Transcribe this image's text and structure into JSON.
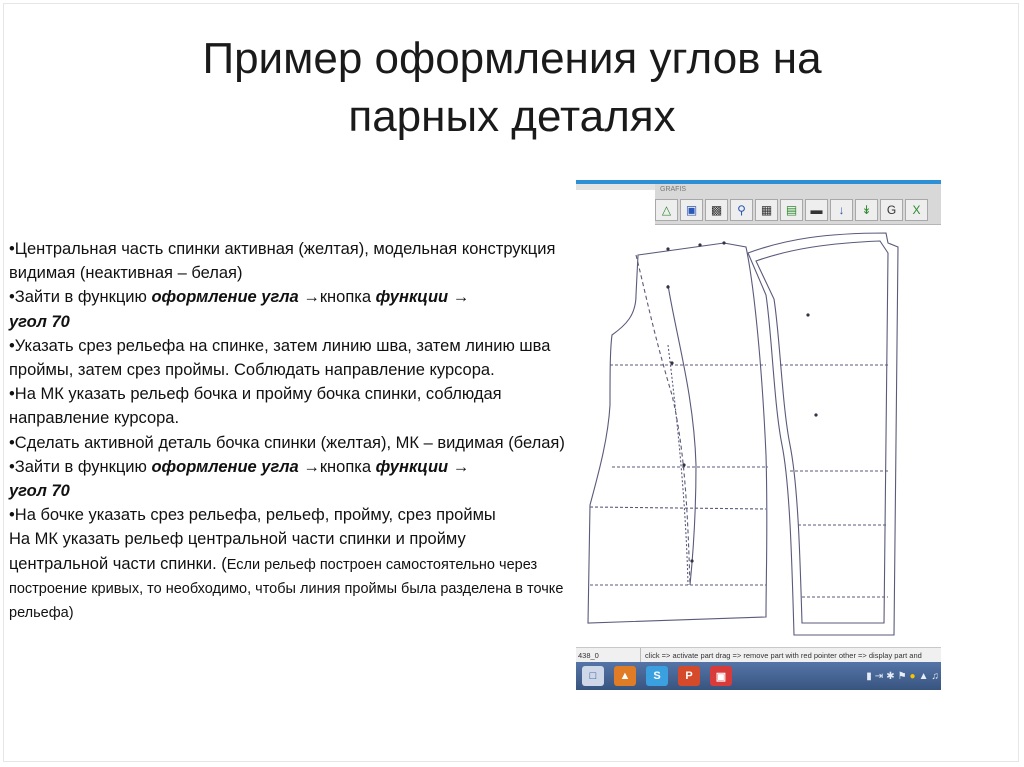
{
  "title": {
    "line1": "Пример оформления углов на",
    "line2": "парных деталях"
  },
  "instructions": {
    "p1": "•Центральная часть спинки активная (желтая), модельная конструкция видимая (неактивная – белая)",
    "p2": {
      "pre": "•Зайти в функцию ",
      "func": "оформление угла",
      "mid": " →кнопка ",
      "btn": "функции",
      "arrow": " →",
      "angle": "угол 70"
    },
    "p3": "•Указать срез рельефа на спинке, затем линию шва, затем линию шва проймы, затем срез проймы. Соблюдать направление курсора.",
    "p4": "•На МК указать рельеф бочка и пройму бочка спинки, соблюдая направление курсора.",
    "p5": "•Сделать активной деталь бочка спинки (желтая), МК – видимая (белая)",
    "p6": {
      "pre": "•Зайти в функцию ",
      "func": "оформление угла",
      "mid": " →кнопка ",
      "btn": "функции",
      "arrow": " →",
      "angle": "угол 70"
    },
    "p7": "•На бочке указать срез рельефа, рельеф, пройму, срез проймы",
    "p8_main": "На МК указать рельеф центральной части спинки и пройму центральной части спинки.  (",
    "p8_small": "Если рельеф построен самостоятельно через построение кривых, то необходимо, чтобы линия проймы была разделена в точке рельефа)"
  },
  "screenshot": {
    "app_name": "GRAFIS",
    "toolbar_icons": [
      "folder-open-icon",
      "save-icon",
      "print-icon",
      "zoom-icon",
      "grid-icon",
      "layers-icon",
      "ruler-icon",
      "download-icon",
      "download-alt-icon",
      "grafis-g-icon",
      "excel-icon"
    ],
    "status_id": "438_0",
    "status_message": "click => activate part drag => remove part with red pointer other => display part and",
    "colors": {
      "window_accent": "#2d8fd6",
      "taskbar": "#4a6a9c",
      "pattern_line": "#5a5a7a"
    }
  }
}
